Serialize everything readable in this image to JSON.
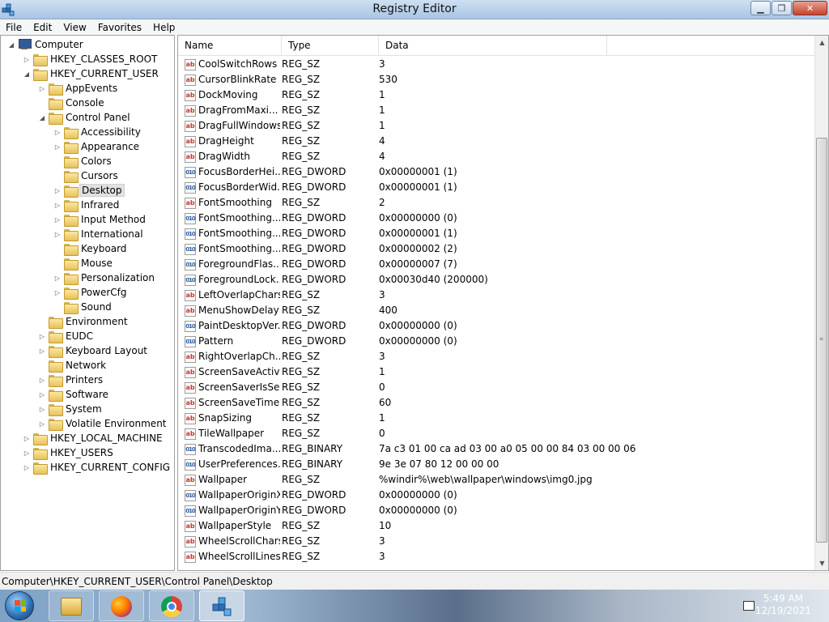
{
  "window": {
    "title": "Registry Editor"
  },
  "menu": [
    "File",
    "Edit",
    "View",
    "Favorites",
    "Help"
  ],
  "tree": [
    {
      "label": "Computer",
      "level": 0,
      "expander": "open",
      "icon": "computer"
    },
    {
      "label": "HKEY_CLASSES_ROOT",
      "level": 1,
      "expander": "closed"
    },
    {
      "label": "HKEY_CURRENT_USER",
      "level": 1,
      "expander": "open"
    },
    {
      "label": "AppEvents",
      "level": 2,
      "expander": "closed"
    },
    {
      "label": "Console",
      "level": 2,
      "expander": "none"
    },
    {
      "label": "Control Panel",
      "level": 2,
      "expander": "open"
    },
    {
      "label": "Accessibility",
      "level": 3,
      "expander": "closed"
    },
    {
      "label": "Appearance",
      "level": 3,
      "expander": "closed"
    },
    {
      "label": "Colors",
      "level": 3,
      "expander": "none"
    },
    {
      "label": "Cursors",
      "level": 3,
      "expander": "none"
    },
    {
      "label": "Desktop",
      "level": 3,
      "expander": "closed",
      "selected": true
    },
    {
      "label": "Infrared",
      "level": 3,
      "expander": "closed"
    },
    {
      "label": "Input Method",
      "level": 3,
      "expander": "closed"
    },
    {
      "label": "International",
      "level": 3,
      "expander": "closed"
    },
    {
      "label": "Keyboard",
      "level": 3,
      "expander": "none"
    },
    {
      "label": "Mouse",
      "level": 3,
      "expander": "none"
    },
    {
      "label": "Personalization",
      "level": 3,
      "expander": "closed"
    },
    {
      "label": "PowerCfg",
      "level": 3,
      "expander": "closed"
    },
    {
      "label": "Sound",
      "level": 3,
      "expander": "none"
    },
    {
      "label": "Environment",
      "level": 2,
      "expander": "none"
    },
    {
      "label": "EUDC",
      "level": 2,
      "expander": "closed"
    },
    {
      "label": "Keyboard Layout",
      "level": 2,
      "expander": "closed"
    },
    {
      "label": "Network",
      "level": 2,
      "expander": "none"
    },
    {
      "label": "Printers",
      "level": 2,
      "expander": "closed"
    },
    {
      "label": "Software",
      "level": 2,
      "expander": "closed"
    },
    {
      "label": "System",
      "level": 2,
      "expander": "closed"
    },
    {
      "label": "Volatile Environment",
      "level": 2,
      "expander": "closed"
    },
    {
      "label": "HKEY_LOCAL_MACHINE",
      "level": 1,
      "expander": "closed"
    },
    {
      "label": "HKEY_USERS",
      "level": 1,
      "expander": "closed"
    },
    {
      "label": "HKEY_CURRENT_CONFIG",
      "level": 1,
      "expander": "closed"
    }
  ],
  "list": {
    "columns": [
      "Name",
      "Type",
      "Data"
    ],
    "rows": [
      {
        "name": "CoolSwitchRows",
        "type": "REG_SZ",
        "data": "3",
        "icon": "string"
      },
      {
        "name": "CursorBlinkRate",
        "type": "REG_SZ",
        "data": "530",
        "icon": "string"
      },
      {
        "name": "DockMoving",
        "type": "REG_SZ",
        "data": "1",
        "icon": "string"
      },
      {
        "name": "DragFromMaxi...",
        "type": "REG_SZ",
        "data": "1",
        "icon": "string"
      },
      {
        "name": "DragFullWindows",
        "type": "REG_SZ",
        "data": "1",
        "icon": "string"
      },
      {
        "name": "DragHeight",
        "type": "REG_SZ",
        "data": "4",
        "icon": "string"
      },
      {
        "name": "DragWidth",
        "type": "REG_SZ",
        "data": "4",
        "icon": "string"
      },
      {
        "name": "FocusBorderHei...",
        "type": "REG_DWORD",
        "data": "0x00000001 (1)",
        "icon": "binary"
      },
      {
        "name": "FocusBorderWid...",
        "type": "REG_DWORD",
        "data": "0x00000001 (1)",
        "icon": "binary"
      },
      {
        "name": "FontSmoothing",
        "type": "REG_SZ",
        "data": "2",
        "icon": "string"
      },
      {
        "name": "FontSmoothing...",
        "type": "REG_DWORD",
        "data": "0x00000000 (0)",
        "icon": "binary"
      },
      {
        "name": "FontSmoothing...",
        "type": "REG_DWORD",
        "data": "0x00000001 (1)",
        "icon": "binary"
      },
      {
        "name": "FontSmoothing...",
        "type": "REG_DWORD",
        "data": "0x00000002 (2)",
        "icon": "binary"
      },
      {
        "name": "ForegroundFlas...",
        "type": "REG_DWORD",
        "data": "0x00000007 (7)",
        "icon": "binary"
      },
      {
        "name": "ForegroundLock...",
        "type": "REG_DWORD",
        "data": "0x00030d40 (200000)",
        "icon": "binary"
      },
      {
        "name": "LeftOverlapChars",
        "type": "REG_SZ",
        "data": "3",
        "icon": "string"
      },
      {
        "name": "MenuShowDelay",
        "type": "REG_SZ",
        "data": "400",
        "icon": "string"
      },
      {
        "name": "PaintDesktopVer...",
        "type": "REG_DWORD",
        "data": "0x00000000 (0)",
        "icon": "binary"
      },
      {
        "name": "Pattern",
        "type": "REG_DWORD",
        "data": "0x00000000 (0)",
        "icon": "binary"
      },
      {
        "name": "RightOverlapCh...",
        "type": "REG_SZ",
        "data": "3",
        "icon": "string"
      },
      {
        "name": "ScreenSaveActive",
        "type": "REG_SZ",
        "data": "1",
        "icon": "string"
      },
      {
        "name": "ScreenSaverIsSe...",
        "type": "REG_SZ",
        "data": "0",
        "icon": "string"
      },
      {
        "name": "ScreenSaveTime...",
        "type": "REG_SZ",
        "data": "60",
        "icon": "string"
      },
      {
        "name": "SnapSizing",
        "type": "REG_SZ",
        "data": "1",
        "icon": "string"
      },
      {
        "name": "TileWallpaper",
        "type": "REG_SZ",
        "data": "0",
        "icon": "string"
      },
      {
        "name": "TranscodedIma...",
        "type": "REG_BINARY",
        "data": "7a c3 01 00 ca ad 03 00 a0 05 00 00 84 03 00 00 06 2...",
        "icon": "binary"
      },
      {
        "name": "UserPreferences...",
        "type": "REG_BINARY",
        "data": "9e 3e 07 80 12 00 00 00",
        "icon": "binary"
      },
      {
        "name": "Wallpaper",
        "type": "REG_SZ",
        "data": "%windir%\\web\\wallpaper\\windows\\img0.jpg",
        "icon": "string"
      },
      {
        "name": "WallpaperOriginX",
        "type": "REG_DWORD",
        "data": "0x00000000 (0)",
        "icon": "binary"
      },
      {
        "name": "WallpaperOriginY",
        "type": "REG_DWORD",
        "data": "0x00000000 (0)",
        "icon": "binary"
      },
      {
        "name": "WallpaperStyle",
        "type": "REG_SZ",
        "data": "10",
        "icon": "string"
      },
      {
        "name": "WheelScrollChars",
        "type": "REG_SZ",
        "data": "3",
        "icon": "string"
      },
      {
        "name": "WheelScrollLines",
        "type": "REG_SZ",
        "data": "3",
        "icon": "string"
      }
    ]
  },
  "statusbar": {
    "path": "Computer\\HKEY_CURRENT_USER\\Control Panel\\Desktop"
  },
  "taskbar": {
    "apps": [
      "file-explorer",
      "firefox",
      "chrome",
      "registry-editor"
    ],
    "clock_time": "5:49 AM",
    "clock_date": "12/19/2021"
  },
  "icons": {
    "string_value": "ab-icon",
    "binary_value": "binary-icon",
    "minimize": "minimize-icon",
    "maximize": "maximize-icon",
    "close": "close-icon"
  },
  "colors": {
    "titlebar": "#b9d1ea",
    "selection": "#e1e1e1",
    "string_icon": "#c0392b",
    "binary_icon": "#2f5ea3"
  }
}
